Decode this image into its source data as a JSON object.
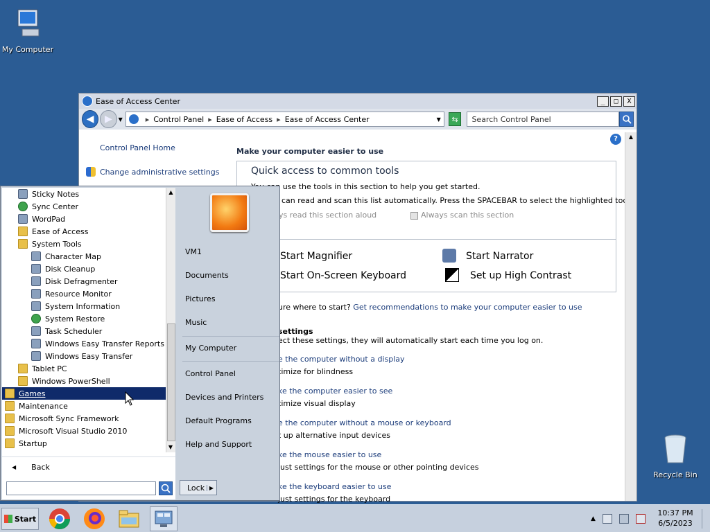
{
  "desktop": {
    "my_computer": "My Computer",
    "recycle_bin": "Recycle Bin"
  },
  "window": {
    "title": "Ease of Access Center",
    "buttons": {
      "minimize": "_",
      "maximize": "□",
      "close": "X"
    },
    "breadcrumb": [
      "Control Panel",
      "Ease of Access",
      "Ease of Access Center"
    ],
    "search_placeholder": "Search Control Panel",
    "left_links": {
      "home": "Control Panel Home",
      "admin": "Change administrative settings"
    },
    "main": {
      "heading": "Make your computer easier to use",
      "quick_title": "Quick access to common tools",
      "quick_line1": "You can use the tools in this section to help you get started.",
      "quick_line2": "can read and scan this list automatically.  Press the SPACEBAR to select the highlighted tool.",
      "always_read": "ys read this section aloud",
      "always_scan": "Always scan this section",
      "tools": {
        "magnifier": "Start Magnifier",
        "narrator": "Start Narrator",
        "keyboard": "Start On-Screen Keyboard",
        "contrast": "Set up High Contrast"
      },
      "not_sure_prefix": "ure where to start?",
      "not_sure_link": "Get recommendations to make your computer easier to use",
      "settings_title": "settings",
      "settings_desc": "ect these settings, they will automatically start each time you log on.",
      "settings": [
        {
          "link": "e the computer without a display",
          "desc": "timize for blindness"
        },
        {
          "link": "ke the computer easier to see",
          "desc": "timize visual display"
        },
        {
          "link": "e the computer without a mouse or keyboard",
          "desc": "t up alternative input devices"
        },
        {
          "link": "ke the mouse easier to use",
          "desc": "just settings for the mouse or other pointing devices"
        },
        {
          "link": "ke the keyboard easier to use",
          "desc": "just settings for the keyboard"
        }
      ]
    }
  },
  "start_menu": {
    "programs": [
      {
        "label": "Sticky Notes",
        "indent": 1,
        "icon": "sticky-notes-icon"
      },
      {
        "label": "Sync Center",
        "indent": 1,
        "icon": "sync-icon"
      },
      {
        "label": "WordPad",
        "indent": 1,
        "icon": "wordpad-icon"
      },
      {
        "label": "Ease of Access",
        "indent": 1,
        "icon": "folder-icon"
      },
      {
        "label": "System Tools",
        "indent": 1,
        "icon": "folder-icon"
      },
      {
        "label": "Character Map",
        "indent": 2,
        "icon": "character-map-icon"
      },
      {
        "label": "Disk Cleanup",
        "indent": 2,
        "icon": "disk-cleanup-icon"
      },
      {
        "label": "Disk Defragmenter",
        "indent": 2,
        "icon": "defrag-icon"
      },
      {
        "label": "Resource Monitor",
        "indent": 2,
        "icon": "resource-monitor-icon"
      },
      {
        "label": "System Information",
        "indent": 2,
        "icon": "system-info-icon"
      },
      {
        "label": "System Restore",
        "indent": 2,
        "icon": "system-restore-icon"
      },
      {
        "label": "Task Scheduler",
        "indent": 2,
        "icon": "task-scheduler-icon"
      },
      {
        "label": "Windows Easy Transfer Reports",
        "indent": 2,
        "icon": "transfer-icon"
      },
      {
        "label": "Windows Easy Transfer",
        "indent": 2,
        "icon": "transfer-icon"
      },
      {
        "label": "Tablet PC",
        "indent": 1,
        "icon": "folder-icon"
      },
      {
        "label": "Windows PowerShell",
        "indent": 1,
        "icon": "folder-icon"
      },
      {
        "label": "Games",
        "indent": 0,
        "icon": "folder-icon",
        "selected": true
      },
      {
        "label": "Maintenance",
        "indent": 0,
        "icon": "folder-icon"
      },
      {
        "label": "Microsoft Sync Framework",
        "indent": 0,
        "icon": "folder-icon"
      },
      {
        "label": "Microsoft Visual Studio 2010",
        "indent": 0,
        "icon": "folder-icon"
      },
      {
        "label": "Startup",
        "indent": 0,
        "icon": "folder-icon"
      }
    ],
    "back": "Back",
    "right": {
      "user": "VM1",
      "documents": "Documents",
      "pictures": "Pictures",
      "music": "Music",
      "computer": "My Computer",
      "control_panel": "Control Panel",
      "devices": "Devices and Printers",
      "default_programs": "Default Programs",
      "help": "Help and Support"
    },
    "lock": "Lock"
  },
  "taskbar": {
    "start": "Start",
    "apps": [
      "chrome-icon",
      "firefox-icon",
      "explorer-icon",
      "control-panel-icon"
    ],
    "time": "10:37 PM",
    "date": "6/5/2023"
  }
}
